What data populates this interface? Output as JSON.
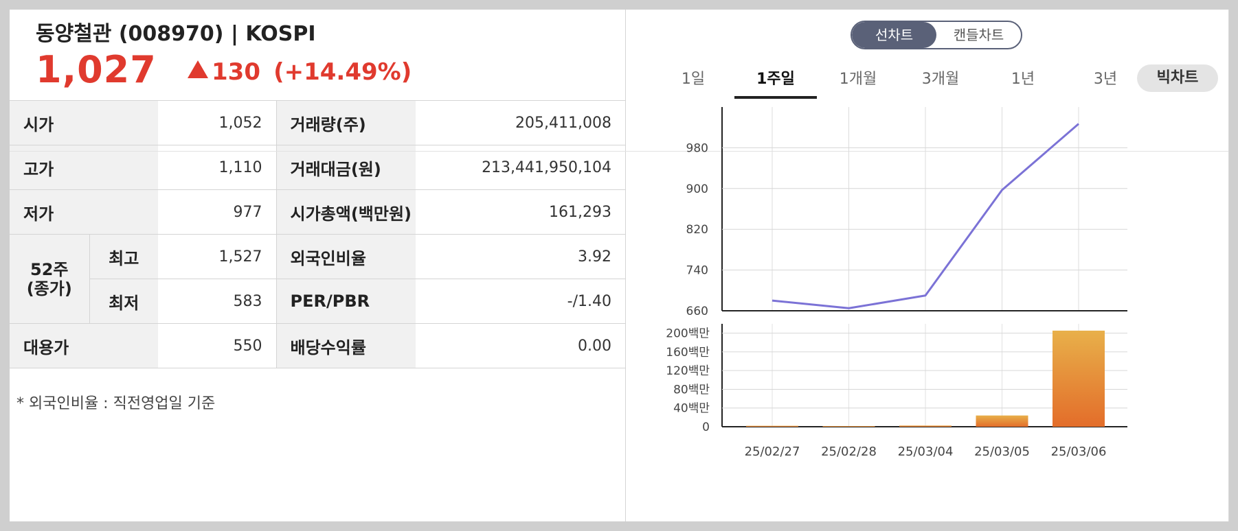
{
  "stock": {
    "name": "동양철관 (008970) | KOSPI",
    "price": "1,027",
    "change": "130",
    "change_pct": "(+14.49%)",
    "color_up": "#e03a2e"
  },
  "table": {
    "rows": [
      {
        "label": "시가",
        "value": "1,052",
        "label2": "거래량(주)",
        "value2": "205,411,008"
      },
      {
        "label": "고가",
        "value": "1,110",
        "label2": "거래대금(원)",
        "value2": "213,441,950,104"
      },
      {
        "label": "저가",
        "value": "977",
        "label2": "시가총액(백만원)",
        "value2": "161,293"
      },
      {
        "group_label": "52주\n(종가)",
        "label": "최고",
        "value": "1,527",
        "label2": "외국인비율",
        "value2": "3.92"
      },
      {
        "label": "최저",
        "value": "583",
        "label2": "PER/PBR",
        "value2": "-/1.40"
      },
      {
        "label": "대용가",
        "value": "550",
        "label2": "배당수익률",
        "value2": "0.00"
      }
    ],
    "group_label_line1": "52주",
    "group_label_line2": "(종가)"
  },
  "footnote": "* 외국인비율 : 직전영업일 기준",
  "toggle": {
    "active": "선차트",
    "inactive": "캔들차트"
  },
  "tabs": [
    {
      "label": "1일",
      "active": false
    },
    {
      "label": "1주일",
      "active": true
    },
    {
      "label": "1개월",
      "active": false
    },
    {
      "label": "3개월",
      "active": false
    },
    {
      "label": "1년",
      "active": false
    },
    {
      "label": "3년",
      "active": false
    }
  ],
  "big_chart_label": "빅차트",
  "chart_data": [
    {
      "type": "line",
      "x": [
        "25/02/27",
        "25/02/28",
        "25/03/04",
        "25/03/05",
        "25/03/06"
      ],
      "series": [
        {
          "values": [
            680,
            665,
            690,
            897,
            1027
          ]
        }
      ],
      "ylim": [
        660,
        1060
      ],
      "yticks": [
        660,
        740,
        820,
        900,
        980
      ],
      "line_color": "#7b72d6",
      "grid": true
    },
    {
      "type": "bar",
      "categories": [
        "25/02/27",
        "25/02/28",
        "25/03/04",
        "25/03/05",
        "25/03/06"
      ],
      "values": [
        2000000,
        300000,
        2500000,
        24000000,
        205411008
      ],
      "ylim": [
        0,
        220000000
      ],
      "yticks": [
        0,
        40000000,
        80000000,
        120000000,
        160000000,
        200000000
      ],
      "ytick_labels": [
        "0",
        "40백만",
        "80백만",
        "120백만",
        "160백만",
        "200백만"
      ],
      "bar_color_top": "#e8b04a",
      "bar_color_bottom": "#e36d2a",
      "grid": true
    }
  ]
}
